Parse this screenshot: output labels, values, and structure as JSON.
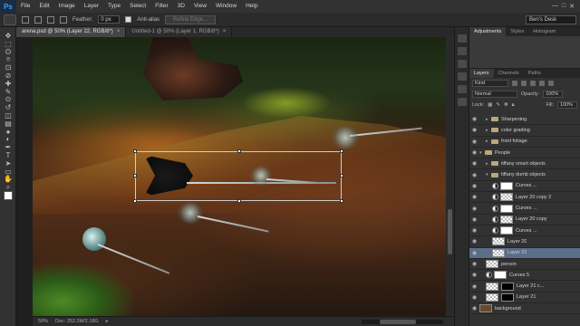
{
  "app": {
    "logo": "Ps"
  },
  "menu": [
    "File",
    "Edit",
    "Image",
    "Layer",
    "Type",
    "Select",
    "Filter",
    "3D",
    "View",
    "Window",
    "Help"
  ],
  "window_controls": [
    "—",
    "□",
    "✕"
  ],
  "options": {
    "feather_label": "Feather:",
    "feather_value": "0 px",
    "antialias_label": "Anti-alias",
    "refine_label": "Refine Edge...",
    "workspace": "Ben's Desk"
  },
  "tools": [
    "move-icon",
    "marquee-icon",
    "lasso-icon",
    "quick-select-icon",
    "crop-icon",
    "eyedropper-icon",
    "healing-icon",
    "brush-icon",
    "stamp-icon",
    "history-brush-icon",
    "eraser-icon",
    "gradient-icon",
    "blur-icon",
    "dodge-icon",
    "pen-icon",
    "type-icon",
    "path-select-icon",
    "shape-icon",
    "hand-icon",
    "zoom-icon"
  ],
  "doc_tabs": [
    {
      "label": "arena.psd @ 50% (Layer 22, RGB/8*)",
      "active": true
    },
    {
      "label": "Untitled-1 @ 50% (Layer 1, RGB/8*)",
      "active": false
    }
  ],
  "status": {
    "zoom": "50%",
    "doc": "Doc: 252.3M/2.18G"
  },
  "panels": {
    "top_tabs": [
      "Adjustments",
      "Styles",
      "Histogram"
    ],
    "layer_tabs": [
      "Layers",
      "Channels",
      "Paths"
    ],
    "kind": "Kind",
    "blend": "Normal",
    "opacity_label": "Opacity:",
    "opacity": "100%",
    "lock_label": "Lock:",
    "fill_label": "Fill:",
    "fill": "100%"
  },
  "layers": [
    {
      "name": "Sharpening",
      "type": "folder",
      "indent": 1,
      "selected": false
    },
    {
      "name": "color grading",
      "type": "folder",
      "indent": 1,
      "selected": false
    },
    {
      "name": "front foliage",
      "type": "folder",
      "indent": 1,
      "selected": false
    },
    {
      "name": "People",
      "type": "folder",
      "indent": 0,
      "selected": false
    },
    {
      "name": "tiffany smart objects",
      "type": "folder",
      "indent": 1,
      "selected": false
    },
    {
      "name": "tiffany dumb objects",
      "type": "folder",
      "indent": 1,
      "selected": false
    },
    {
      "name": "Curves ...",
      "type": "adj-white",
      "indent": 2,
      "selected": false
    },
    {
      "name": "Layer 20 copy 2",
      "type": "layer-adj",
      "indent": 2,
      "selected": false
    },
    {
      "name": "Curves ...",
      "type": "adj-white",
      "indent": 2,
      "selected": false
    },
    {
      "name": "Layer 20 copy",
      "type": "layer-adj",
      "indent": 2,
      "selected": false
    },
    {
      "name": "Curves ...",
      "type": "adj-white",
      "indent": 2,
      "selected": false
    },
    {
      "name": "Layer 20",
      "type": "layer",
      "indent": 2,
      "selected": false
    },
    {
      "name": "Layer 22",
      "type": "layer",
      "indent": 2,
      "selected": true
    },
    {
      "name": "person",
      "type": "layer",
      "indent": 1,
      "selected": false
    },
    {
      "name": "Curves 5",
      "type": "adj-white",
      "indent": 1,
      "selected": false
    },
    {
      "name": "Layer 21 c...",
      "type": "layer-black",
      "indent": 1,
      "selected": false
    },
    {
      "name": "Layer 21",
      "type": "layer-black",
      "indent": 1,
      "selected": false
    },
    {
      "name": "background",
      "type": "layer",
      "indent": 0,
      "selected": false
    }
  ]
}
